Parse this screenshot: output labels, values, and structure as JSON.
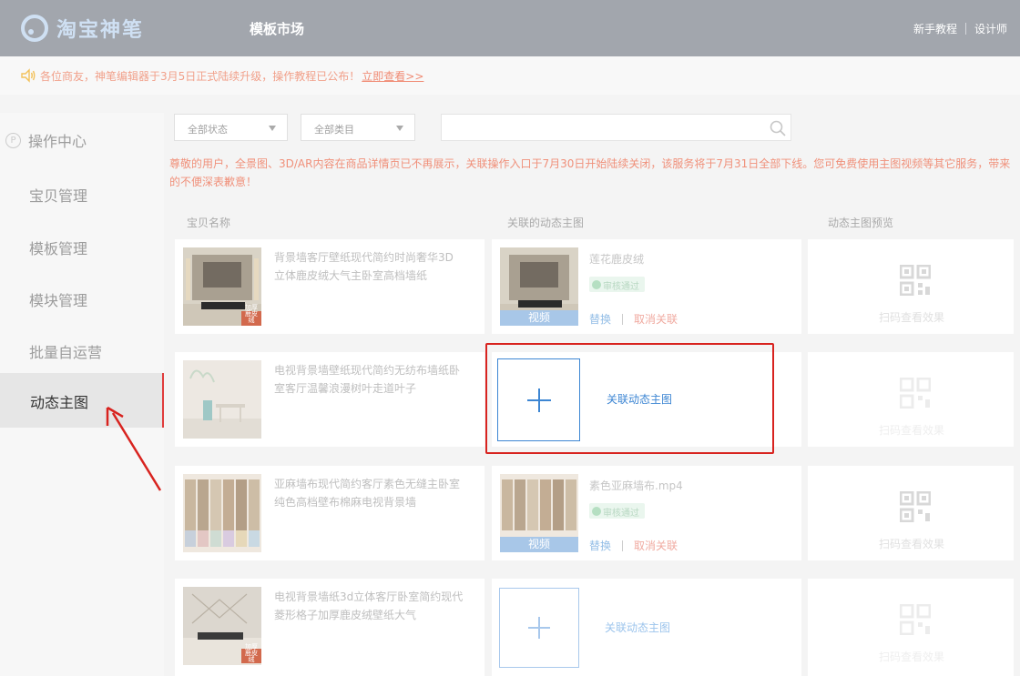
{
  "header": {
    "logo_text": "淘宝神笔",
    "nav_market": "模板市场",
    "links": [
      "新手教程",
      "设计师"
    ]
  },
  "notice": {
    "text": "各位商友，神笔编辑器于3月5日正式陆续升级，操作教程已公布！",
    "link": "立即查看>>"
  },
  "sidebar": {
    "items": [
      "操作中心",
      "宝贝管理",
      "模板管理",
      "模块管理",
      "批量自运营",
      "动态主图"
    ],
    "active_index": 5
  },
  "filters": {
    "status": "全部状态",
    "category": "全部类目",
    "search_value": ""
  },
  "warning": "尊敬的用户，全景图、3D/AR内容在商品详情页已不再展示，关联操作入口于7月30日开始陆续关闭，该服务将于7月31日全部下线。您可免费使用主图视频等其它服务，带来的不便深表歉意！",
  "table": {
    "headers": [
      "宝贝名称",
      "关联的动态主图",
      "动态主图预览"
    ],
    "rows": [
      {
        "name_line1": "背景墙客厅壁纸现代简约时尚奢华3D",
        "name_line2": "立体鹿皮绒大气主卧室高档墙纸",
        "linked": true,
        "video_name": "莲花鹿皮绒",
        "status": "审核通过",
        "video_tag": "视频",
        "replace": "替换",
        "unlink": "取消关联",
        "thumb_tag": "加厚 鹿皮绒"
      },
      {
        "name_line1": "电视背景墙壁纸现代简约无纺布墙纸卧",
        "name_line2": "室客厅温馨浪漫树叶走道叶子",
        "linked": false,
        "link_action": "关联动态主图"
      },
      {
        "name_line1": "亚麻墙布现代简约客厅素色无缝主卧室",
        "name_line2": "纯色高档壁布棉麻电视背景墙",
        "linked": true,
        "video_name": "素色亚麻墙布.mp4",
        "status": "审核通过",
        "video_tag": "视频",
        "replace": "替换",
        "unlink": "取消关联"
      },
      {
        "name_line1": "电视背景墙纸3d立体客厅卧室简约现代",
        "name_line2": "菱形格子加厚鹿皮绒壁纸大气",
        "linked": false,
        "link_action": "关联动态主图",
        "thumb_tag": "加厚 鹿皮绒"
      }
    ],
    "qr_text": "扫码查看效果"
  },
  "colors": {
    "header_bg": "#a2a6ad",
    "accent_blue": "#3d86d3",
    "warning_red": "#f0907a",
    "highlight_red": "#d8231f"
  }
}
